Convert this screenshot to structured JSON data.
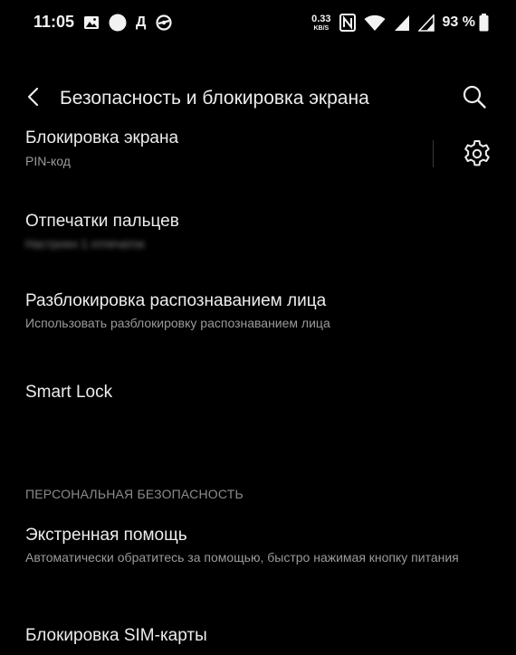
{
  "status_bar": {
    "time": "11:05",
    "notification_icons": [
      "gallery-icon",
      "circle-icon",
      "letter-d-icon",
      "sync-icon"
    ],
    "letter_icon": "Д",
    "network_speed_value": "0.33",
    "network_speed_unit": "KB/S",
    "nfc_icon": "nfc-icon",
    "wifi_icon": "wifi-icon",
    "signal_icons": [
      "signal-icon",
      "signal-icon"
    ],
    "battery_percent": "93 %",
    "battery_icon": "battery-icon"
  },
  "app_bar": {
    "back_icon": "back-arrow-icon",
    "title": "Безопасность и блокировка экрана",
    "search_icon": "search-icon"
  },
  "items": {
    "screen_lock": {
      "title": "Блокировка экрана",
      "subtitle": "PIN-код",
      "settings_icon": "gear-icon"
    },
    "fingerprints": {
      "title": "Отпечатки пальцев",
      "subtitle": "Настроен 1 отпечаток"
    },
    "face_unlock": {
      "title": "Разблокировка распознаванием лица",
      "subtitle": "Использовать разблокировку распознаванием лица"
    },
    "smart_lock": {
      "title": "Smart Lock"
    },
    "personal_safety_header": "ПЕРСОНАЛЬНАЯ БЕЗОПАСНОСТЬ",
    "emergency": {
      "title": "Экстренная помощь",
      "subtitle": "Автоматически обратитесь за помощью, быстро нажимая кнопку питания"
    },
    "sim_lock": {
      "title": "Блокировка SIM-карты"
    }
  },
  "colors": {
    "background": "#000000",
    "primary_text": "#ececec",
    "secondary_text": "#9a9a9a"
  }
}
